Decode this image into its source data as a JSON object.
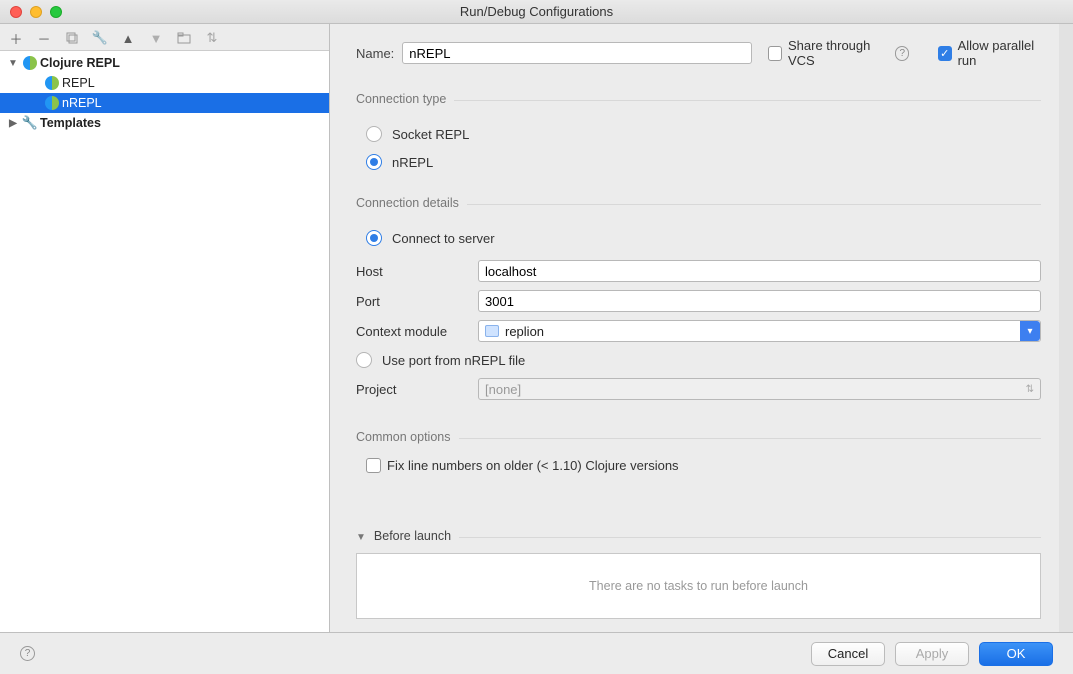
{
  "window": {
    "title": "Run/Debug Configurations"
  },
  "tree": {
    "group_label": "Clojure REPL",
    "items": [
      "REPL",
      "nREPL"
    ],
    "templates_label": "Templates",
    "selected_index": 1
  },
  "toprow": {
    "name_label": "Name:",
    "name_value": "nREPL",
    "share_label": "Share through VCS",
    "share_checked": false,
    "parallel_label": "Allow parallel run",
    "parallel_checked": true
  },
  "conn_type": {
    "title": "Connection type",
    "options": [
      "Socket REPL",
      "nREPL"
    ],
    "selected": 1
  },
  "conn_details": {
    "title": "Connection details",
    "connect_label": "Connect to server",
    "connect_selected": true,
    "host_label": "Host",
    "host_value": "localhost",
    "port_label": "Port",
    "port_value": "3001",
    "context_label": "Context module",
    "context_value": "replion",
    "use_port_label": "Use port from nREPL file",
    "use_port_checked": false,
    "project_label": "Project",
    "project_value": "[none]"
  },
  "common": {
    "title": "Common options",
    "fix_label": "Fix line numbers on older (< 1.10) Clojure versions",
    "fix_checked": false
  },
  "before_launch": {
    "title": "Before launch",
    "empty_text": "There are no tasks to run before launch"
  },
  "buttons": {
    "cancel": "Cancel",
    "apply": "Apply",
    "ok": "OK"
  }
}
